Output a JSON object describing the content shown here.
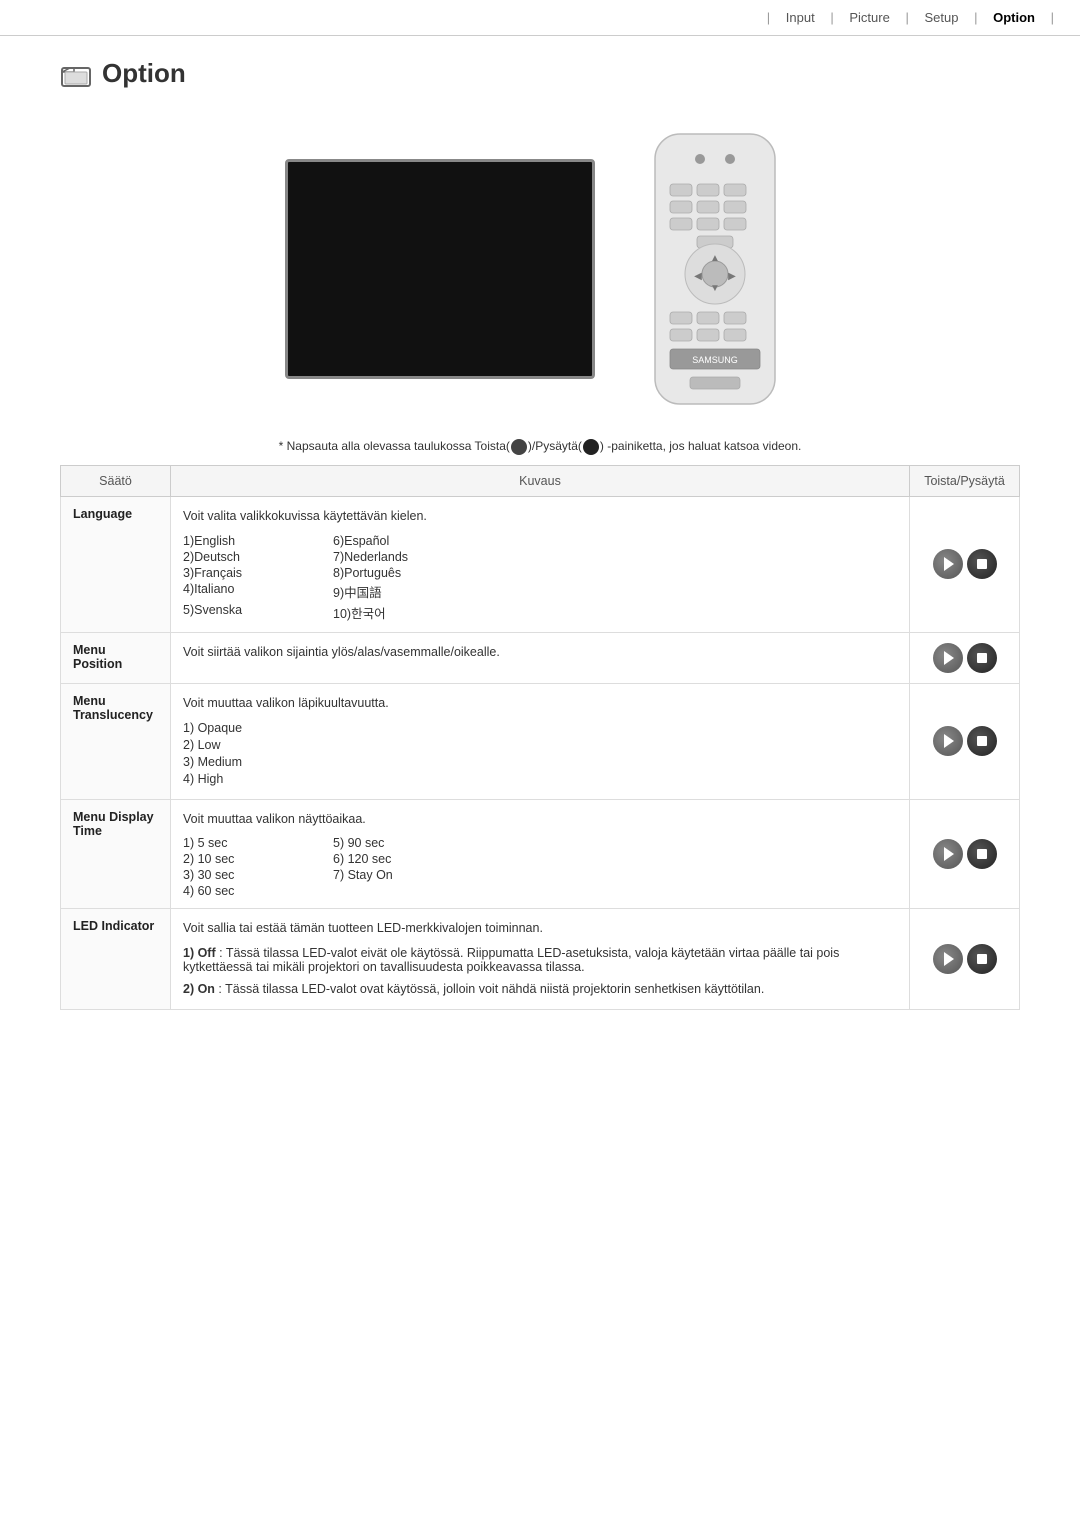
{
  "nav": {
    "separator": "|",
    "items": [
      {
        "label": "Input",
        "active": false
      },
      {
        "label": "Picture",
        "active": false
      },
      {
        "label": "Setup",
        "active": false
      },
      {
        "label": "Option",
        "active": true
      }
    ]
  },
  "page": {
    "title": "Option",
    "icon_label": "option-icon"
  },
  "instruction": "* Napsauta alla olevassa taulukossa Toista(",
  "instruction_middle": ")/Pysäytä(",
  "instruction_end": ") -painiketta, jos haluat katsoa videon.",
  "table": {
    "headers": [
      "Säätö",
      "Kuvaus",
      "Toista/Pysäytä"
    ],
    "rows": [
      {
        "setting": "Language",
        "description_main": "Voit valita valikkokuvissa käytettävän kielen.",
        "sub_items": [
          {
            "col1": "1)English",
            "col2": "6)Español"
          },
          {
            "col1": "2)Deutsch",
            "col2": "7)Nederlands"
          },
          {
            "col1": "3)Français",
            "col2": "8)Português"
          },
          {
            "col1": "4)Italiano",
            "col2": "9)中国語"
          },
          {
            "col1": "5)Svenska",
            "col2": "10)한국어"
          }
        ],
        "has_buttons": true
      },
      {
        "setting": "Menu Position",
        "description_main": "Voit siirtää valikon sijaintia ylös/alas/vasemmalle/oikealle.",
        "sub_items": [],
        "has_buttons": true
      },
      {
        "setting": "Menu Translucency",
        "description_main": "Voit muuttaa valikon läpikuultavuutta.",
        "sub_items_single": [
          "1) Opaque",
          "2) Low",
          "3) Medium",
          "4) High"
        ],
        "has_buttons": true
      },
      {
        "setting": "Menu Display Time",
        "description_main": "Voit muuttaa valikon näyttöaikaa.",
        "sub_items": [
          {
            "col1": "1) 5 sec",
            "col2": "5) 90 sec"
          },
          {
            "col1": "2) 10 sec",
            "col2": "6) 120 sec"
          },
          {
            "col1": "3) 30 sec",
            "col2": "7) Stay On"
          },
          {
            "col1": "4) 60 sec",
            "col2": ""
          }
        ],
        "has_buttons": true
      },
      {
        "setting": "LED Indicator",
        "description_main": "Voit sallia tai estää tämän tuotteen LED-merkkivalojen toiminnan.",
        "sub_items_detail": [
          {
            "label": "1) Off",
            "text": ": Tässä tilassa LED-valot eivät ole käytössä. Riippumatta LED-asetuksista, valoja käytetään virtaa päälle tai pois kytkettäessä tai mikäli projektori on tavallisuudesta poikkeavassa tilassa."
          },
          {
            "label": "2) On",
            "text": ": Tässä tilassa LED-valot ovat käytössä, jolloin voit nähdä niistä projektorin senhetkisen käyttötilan."
          }
        ],
        "has_buttons": true
      }
    ]
  }
}
